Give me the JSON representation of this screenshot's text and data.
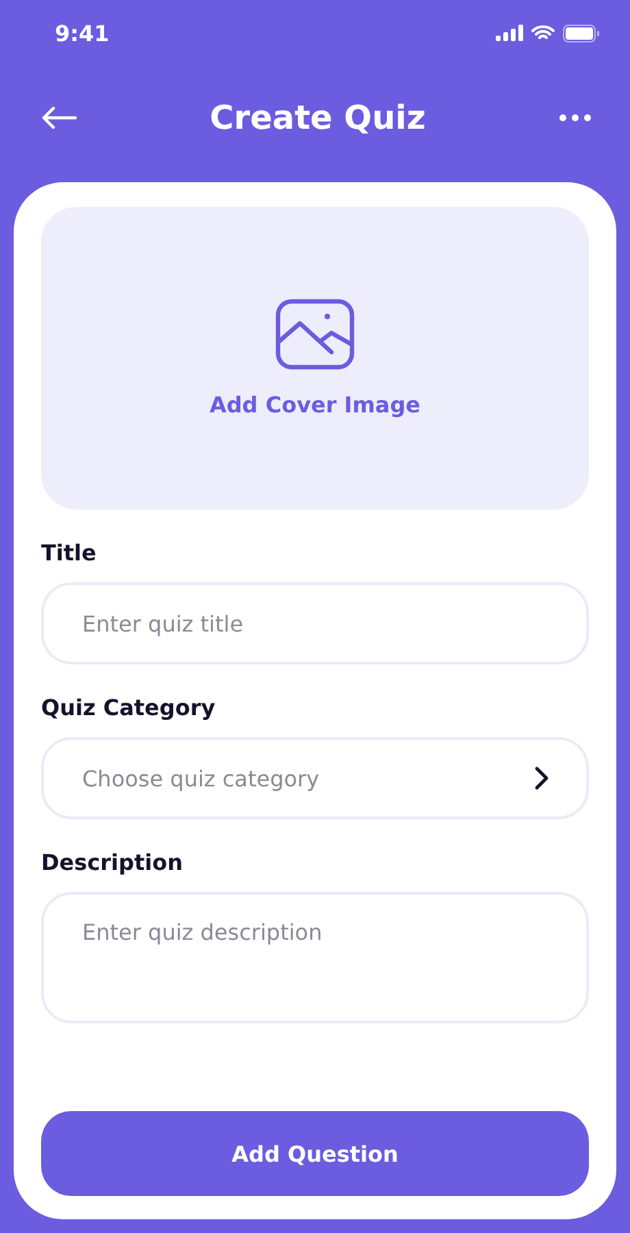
{
  "status_bar": {
    "time": "9:41"
  },
  "header": {
    "title": "Create Quiz"
  },
  "cover": {
    "label": "Add Cover Image"
  },
  "fields": [
    {
      "kind": "text",
      "label": "Title",
      "placeholder": "Enter quiz title"
    },
    {
      "kind": "select",
      "label": "Quiz Category",
      "placeholder": "Choose quiz category"
    },
    {
      "kind": "textarea",
      "label": "Description",
      "placeholder": "Enter quiz description"
    }
  ],
  "primary_button": {
    "label": "Add Question"
  }
}
